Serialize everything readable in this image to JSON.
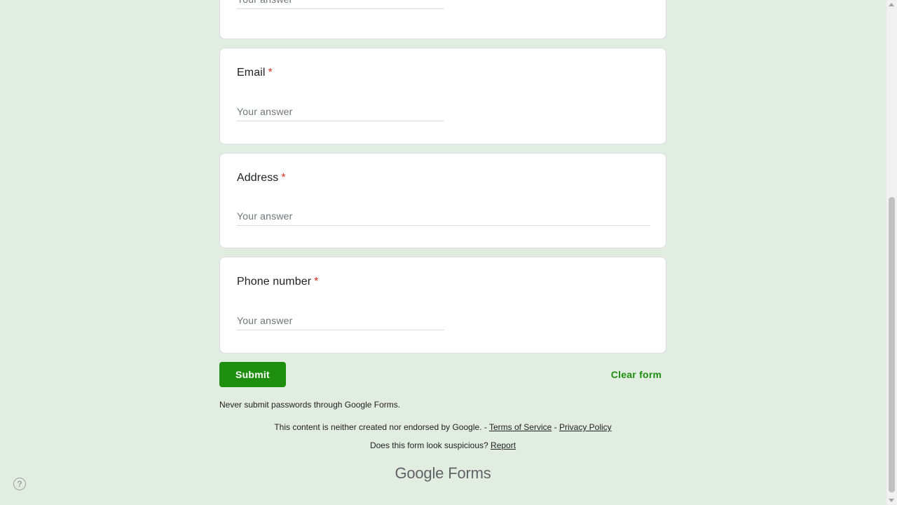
{
  "form": {
    "questions": [
      {
        "title": "",
        "required": "",
        "placeholder": "Your answer"
      },
      {
        "title": "Email",
        "required": "*",
        "placeholder": "Your answer"
      },
      {
        "title": "Address",
        "required": "*",
        "placeholder": "Your answer"
      },
      {
        "title": "Phone number",
        "required": "*",
        "placeholder": "Your answer"
      }
    ],
    "submit_label": "Submit",
    "clear_label": "Clear form",
    "password_warning": "Never submit passwords through Google Forms."
  },
  "footer": {
    "disclaimer": "This content is neither created nor endorsed by Google. -",
    "terms_label": "Terms of Service",
    "separator": "-",
    "privacy_label": "Privacy Policy",
    "suspicious_text": "Does this form look suspicious?",
    "report_label": "Report",
    "brand_google": "Google",
    "brand_forms": "Forms"
  },
  "colors": {
    "background": "#e2ede1",
    "accent": "#1e8e0e",
    "required": "#d93025"
  },
  "icons": {
    "help": "help-circle-icon",
    "help_glyph": "?"
  }
}
